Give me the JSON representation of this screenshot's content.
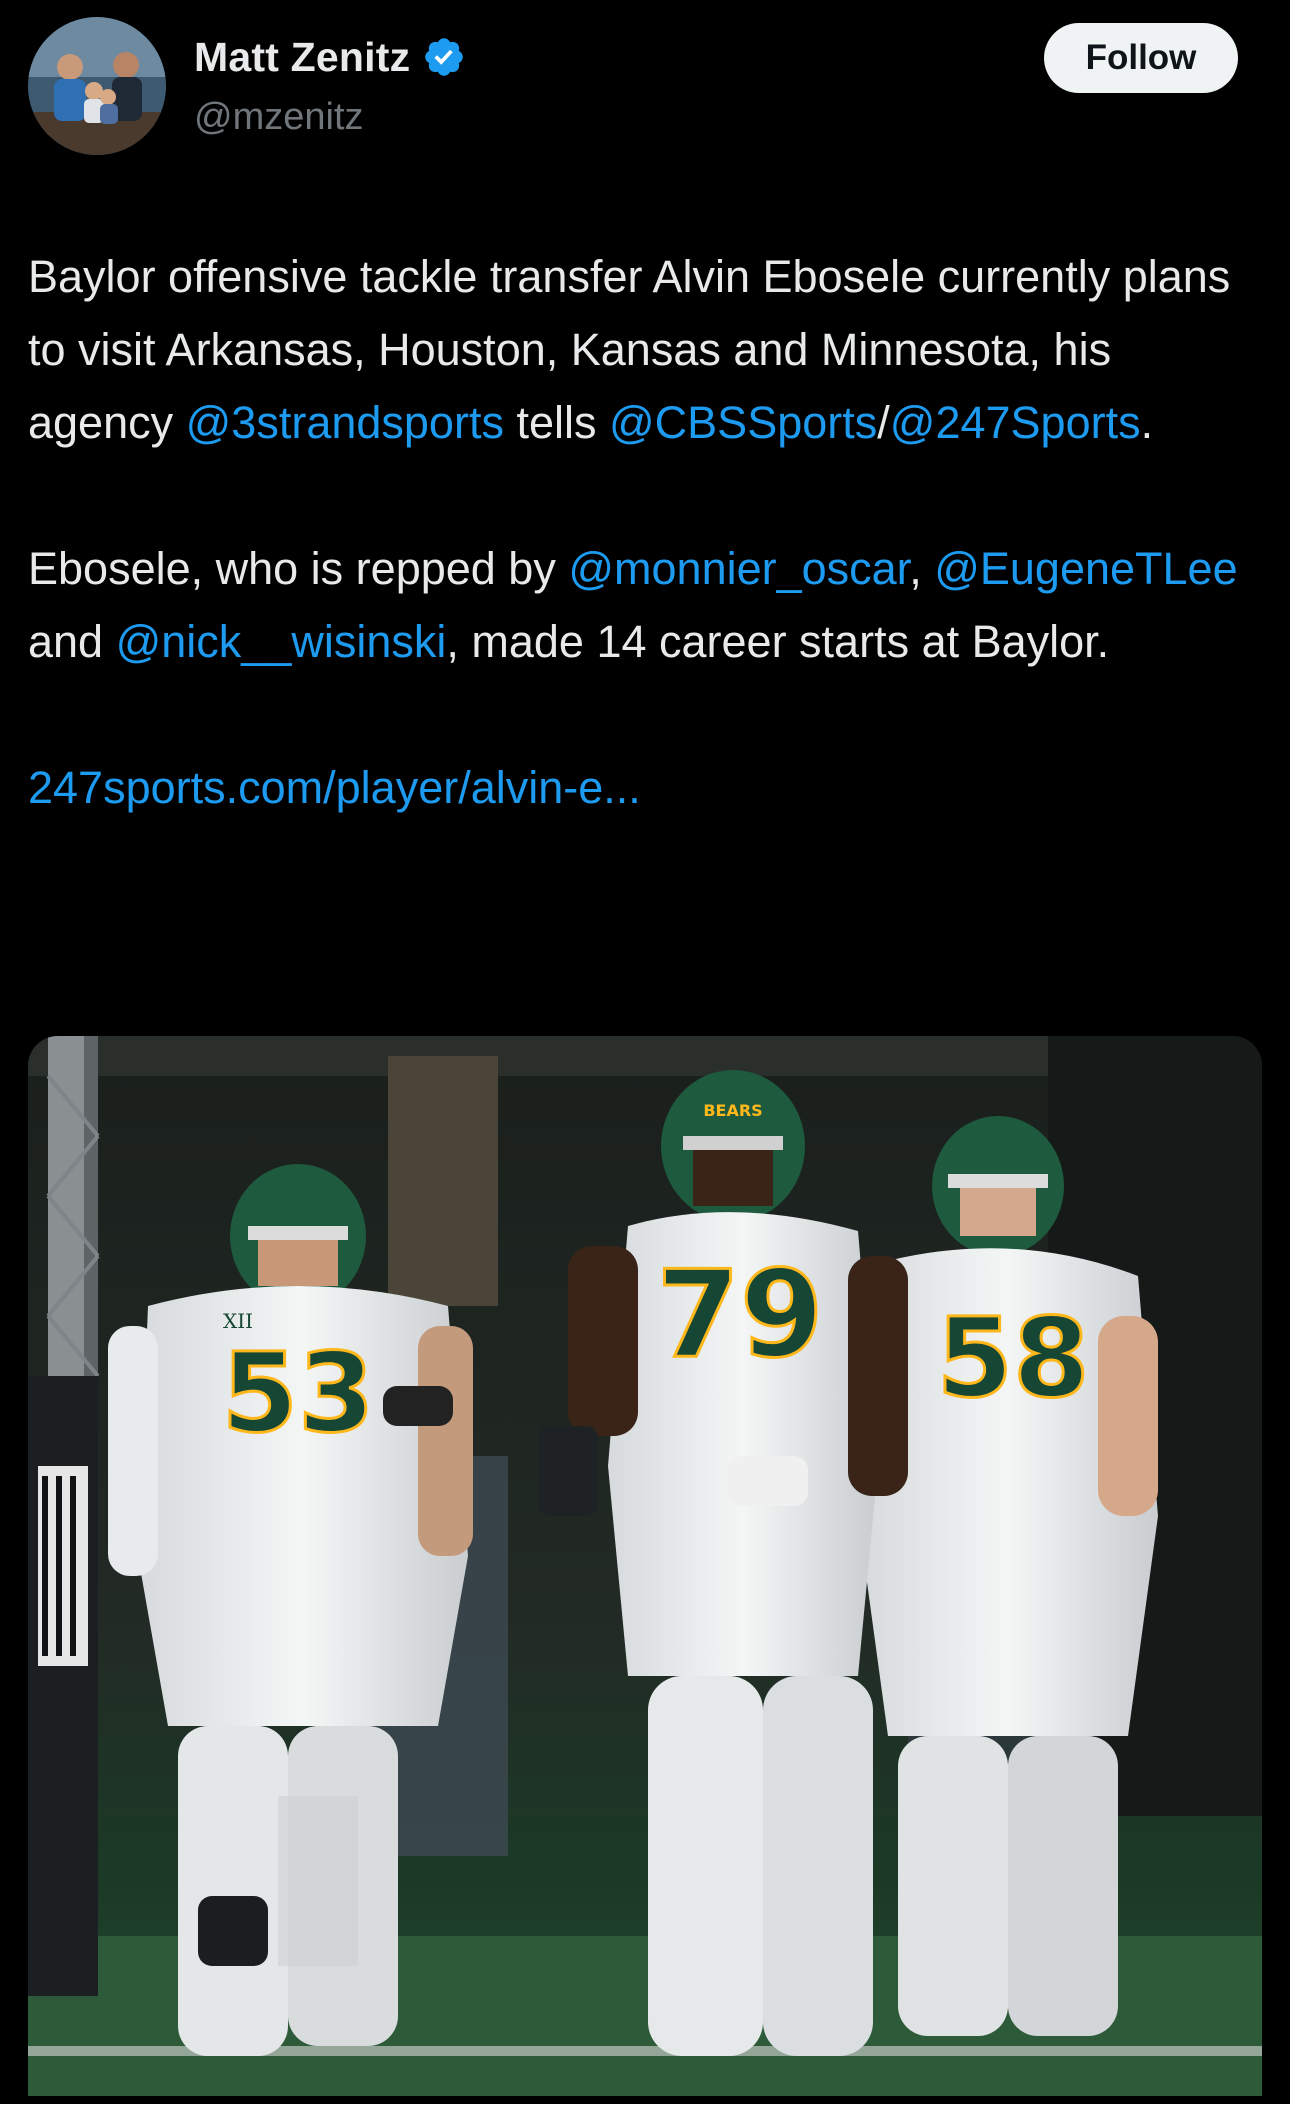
{
  "author": {
    "display_name": "Matt Zenitz",
    "handle": "@mzenitz",
    "verified_icon": "verified-badge-icon",
    "avatar_icon": "avatar"
  },
  "follow_button": {
    "label": "Follow"
  },
  "tweet": {
    "p1_text_1": "Baylor offensive tackle transfer Alvin Ebosele currently plans to visit Arkansas, Houston, Kansas and Minnesota, his agency ",
    "p1_mention_1": "@3strandsports",
    "p1_text_2": " tells ",
    "p1_mention_2": "@CBSSports",
    "p1_text_3": "/",
    "p1_mention_3": "@247Sports",
    "p1_text_4": ".",
    "p2_text_1": "Ebosele, who is repped by ",
    "p2_mention_1": "@monnier_oscar",
    "p2_text_2": ", ",
    "p2_mention_2": "@EugeneTLee",
    "p2_text_3": " and ",
    "p2_mention_3": "@nick__wisinski",
    "p2_text_4": ", made 14 career starts at Baylor.",
    "link": "247sports.com/player/alvin-e..."
  },
  "media": {
    "jersey_numbers": [
      "53",
      "79",
      "58"
    ],
    "helmet_text": "BEARS",
    "conference_mark": "XII"
  },
  "colors": {
    "background": "#000000",
    "text": "#e7e9ea",
    "secondary_text": "#71767b",
    "link": "#1d9bf0",
    "verified": "#1d9bf0",
    "follow_bg": "#eff3f4",
    "baylor_green": "#154734",
    "baylor_gold": "#ffb81c"
  }
}
